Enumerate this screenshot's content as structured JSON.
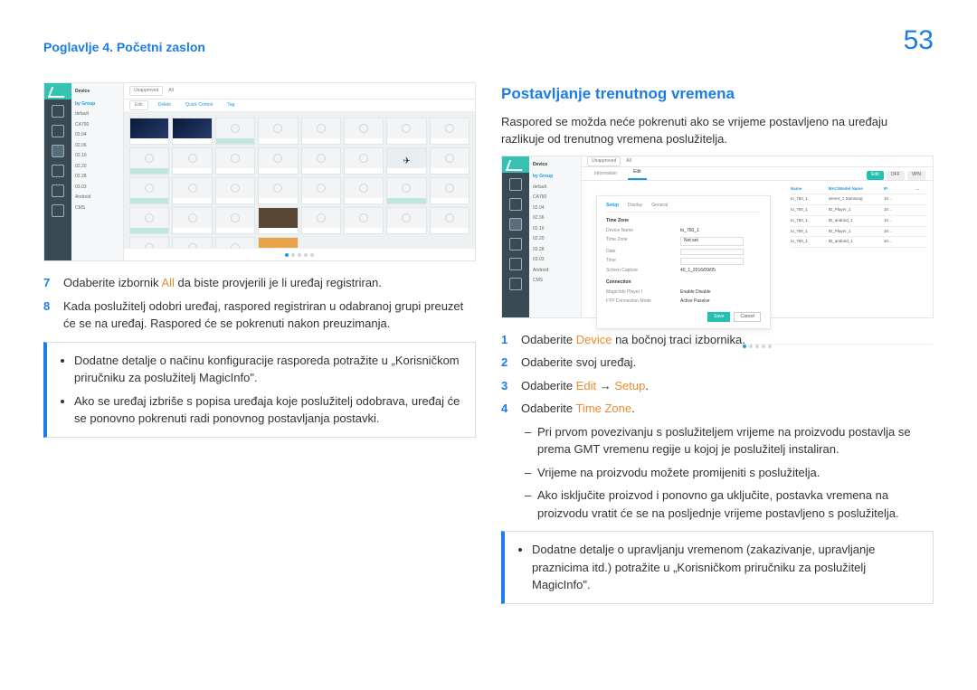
{
  "header": {
    "chapter": "Poglavlje 4. Početni zaslon",
    "page_number": "53"
  },
  "left": {
    "step7": {
      "n": "7",
      "t1": "Odaberite izbornik ",
      "hl": "All",
      "t2": " da biste provjerili je li uređaj registriran."
    },
    "step8": {
      "n": "8",
      "text": "Kada poslužitelj odobri uređaj, raspored registriran u odabranoj grupi preuzet će se na uređaj. Raspored će se pokrenuti nakon preuzimanja."
    },
    "note1": "Dodatne detalje o načinu konfiguracije rasporeda potražite u „Korisničkom priručniku za poslužitelj MagicInfo\".",
    "note2": "Ako se uređaj izbriše s popisa uređaja koje poslužitelj odobrava, uređaj će se ponovno pokrenuti radi ponovnog postavljanja postavki."
  },
  "right": {
    "title": "Postavljanje trenutnog vremena",
    "lead": "Raspored se možda neće pokrenuti ako se vrijeme postavljeno na uređaju razlikuje od trenutnog vremena poslužitelja.",
    "step1": {
      "n": "1",
      "t1": "Odaberite ",
      "hl": "Device",
      "t2": " na bočnoj traci izbornika."
    },
    "step2": {
      "n": "2",
      "text": "Odaberite svoj uređaj."
    },
    "step3": {
      "n": "3",
      "t1": "Odaberite ",
      "hl1": "Edit",
      "arrow": " → ",
      "hl2": "Setup",
      "t2": "."
    },
    "step4": {
      "n": "4",
      "t1": "Odaberite ",
      "hl": "Time Zone",
      "t2": "."
    },
    "dash1": "Pri prvom povezivanju s poslužiteljem vrijeme na proizvodu postavlja se prema GMT vremenu regije u kojoj je poslužitelj instaliran.",
    "dash2": "Vrijeme na proizvodu možete promijeniti s poslužitelja.",
    "dash3": "Ako isključite proizvod i ponovno ga uključite, postavka vremena na proizvodu vratit će se na posljednje vrijeme postavljeno s poslužitelja.",
    "note": "Dodatne detalje o upravljanju vremenom (zakazivanje, upravljanje praznicima itd.) potražite u „Korisničkom priručniku za poslužitelj MagicInfo\"."
  },
  "ss1": {
    "nav_title": "Device",
    "sidebar": [
      "by Group",
      "default",
      "CA750",
      "02.04",
      "02.06",
      "02.10",
      "02.20",
      "02.28",
      "03.03",
      "Android",
      "CMS"
    ],
    "topbar": [
      "Unapproved",
      "All"
    ],
    "subbar": [
      "Edit",
      "Delete",
      "Quick Control",
      "Tag"
    ]
  },
  "ss2": {
    "nav_title": "Device",
    "sidebar": [
      "by Group",
      "default",
      "CA750",
      "02.04",
      "02.06",
      "02.10",
      "02.20",
      "02.28",
      "03.03",
      "Android",
      "CMS"
    ],
    "tabs": [
      "Information",
      "Edit"
    ],
    "ribbon": [
      "Edit",
      "OFF",
      "VPN"
    ],
    "panel_tabs": [
      "Setup",
      "Display",
      "General"
    ],
    "section": "Time Zone",
    "rows": [
      {
        "k": "Device Name",
        "v": "to_750_1"
      },
      {
        "k": "Time Zone",
        "v": "Not set"
      },
      {
        "k": "Date",
        "v": ""
      },
      {
        "k": "Time",
        "v": ""
      },
      {
        "k": "Screen Capture",
        "v": "40_1_2016/09/05"
      },
      {
        "k": "Connection",
        "v": ""
      },
      {
        "k": "MagicInfo Player I",
        "v": "Enable   Disable"
      },
      {
        "k": "FTP Connection Mode",
        "v": "Active   Passive"
      }
    ],
    "btns": [
      "Save",
      "Cancel"
    ],
    "thead": [
      "Name",
      "MAC/Model Name",
      "IP",
      "…"
    ],
    "trows": [
      [
        "to_750_1",
        "server_1 Samsung",
        "10…",
        ""
      ],
      [
        "to_750_1",
        "ID_Player_1",
        "10…",
        ""
      ],
      [
        "to_750_1",
        "ID_android_1",
        "10…",
        ""
      ],
      [
        "to_750_1",
        "ID_Player_1",
        "10…",
        ""
      ],
      [
        "to_750_1",
        "ID_android_1",
        "10…",
        ""
      ]
    ]
  }
}
